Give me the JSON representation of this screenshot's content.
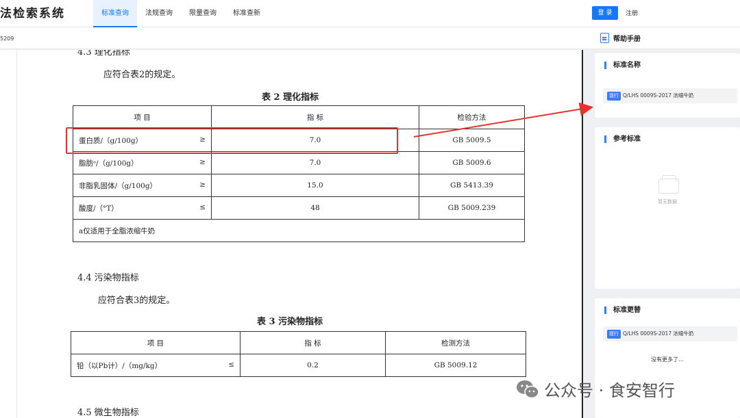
{
  "topbar": {
    "logo": "法检索系统",
    "nav": [
      "标准查询",
      "法规查询",
      "限量查询",
      "标准查新"
    ],
    "login": "登 录",
    "register": "注册"
  },
  "subbar": {
    "doc_code": "5209",
    "help_manual": "帮助手册"
  },
  "document": {
    "partial_heading": "4.3  理化指标",
    "para1": "应符合表2的规定。",
    "table2_caption": "表 2   理化指标",
    "table2": {
      "headers": [
        "项    目",
        "指    标",
        "检验方法"
      ],
      "rows": [
        {
          "item": "蛋白质/（g/100g）",
          "sym": "≥",
          "value": "7.0",
          "method": "GB 5009.5"
        },
        {
          "item": "脂肪ᵃ/（g/100g）",
          "sym": "≥",
          "value": "7.0",
          "method": "GB 5009.6"
        },
        {
          "item": "非脂乳固体/（g/100g）",
          "sym": "≥",
          "value": "15.0",
          "method": "GB 5413.39"
        },
        {
          "item": "酸度/（°T）",
          "sym": "≤",
          "value": "48",
          "method": "GB 5009.239"
        }
      ],
      "footnote": "a仅适用于全脂浓缩牛奶"
    },
    "heading44": "4.4  污染物指标",
    "para2": "应符合表3的规定。",
    "table3_caption": "表 3   污染物指标",
    "table3": {
      "headers": [
        "项    目",
        "指    标",
        "检测方法"
      ],
      "rows": [
        {
          "item": "铅（以Pb计）/（mg/kg）",
          "sym": "≤",
          "value": "0.2",
          "method": "GB 5009.12"
        }
      ]
    },
    "heading45": "4.5  微生物指标"
  },
  "sidebar": {
    "std_name": {
      "title": "标准名称",
      "status": "现行",
      "name": "Q/LHS 0009S-2017 浓缩牛奶"
    },
    "reference": {
      "title": "参考标准",
      "empty": "暂无数据"
    },
    "replacement": {
      "title": "标准更替",
      "status": "现行",
      "name": "Q/LHS 0009S-2017 浓缩牛奶",
      "no_more": "没有更多了..."
    }
  },
  "watermark": "公众号 · 食安智行",
  "colors": {
    "accent": "#1677ff",
    "highlight": "#e8312a",
    "badge": "#3a7cf0"
  }
}
